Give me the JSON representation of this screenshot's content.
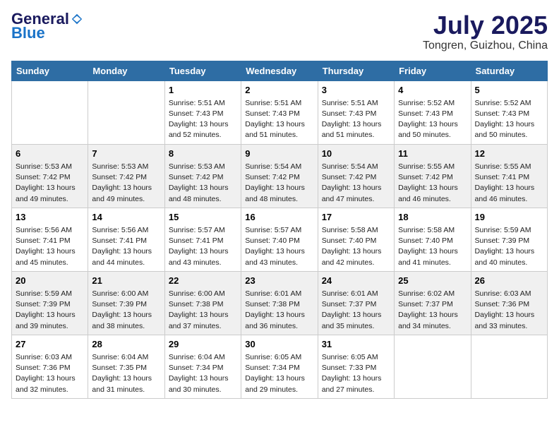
{
  "header": {
    "logo_general": "General",
    "logo_blue": "Blue",
    "month": "July 2025",
    "location": "Tongren, Guizhou, China"
  },
  "weekdays": [
    "Sunday",
    "Monday",
    "Tuesday",
    "Wednesday",
    "Thursday",
    "Friday",
    "Saturday"
  ],
  "weeks": [
    [
      {
        "day": "",
        "info": ""
      },
      {
        "day": "",
        "info": ""
      },
      {
        "day": "1",
        "info": "Sunrise: 5:51 AM\nSunset: 7:43 PM\nDaylight: 13 hours\nand 52 minutes."
      },
      {
        "day": "2",
        "info": "Sunrise: 5:51 AM\nSunset: 7:43 PM\nDaylight: 13 hours\nand 51 minutes."
      },
      {
        "day": "3",
        "info": "Sunrise: 5:51 AM\nSunset: 7:43 PM\nDaylight: 13 hours\nand 51 minutes."
      },
      {
        "day": "4",
        "info": "Sunrise: 5:52 AM\nSunset: 7:43 PM\nDaylight: 13 hours\nand 50 minutes."
      },
      {
        "day": "5",
        "info": "Sunrise: 5:52 AM\nSunset: 7:43 PM\nDaylight: 13 hours\nand 50 minutes."
      }
    ],
    [
      {
        "day": "6",
        "info": "Sunrise: 5:53 AM\nSunset: 7:42 PM\nDaylight: 13 hours\nand 49 minutes."
      },
      {
        "day": "7",
        "info": "Sunrise: 5:53 AM\nSunset: 7:42 PM\nDaylight: 13 hours\nand 49 minutes."
      },
      {
        "day": "8",
        "info": "Sunrise: 5:53 AM\nSunset: 7:42 PM\nDaylight: 13 hours\nand 48 minutes."
      },
      {
        "day": "9",
        "info": "Sunrise: 5:54 AM\nSunset: 7:42 PM\nDaylight: 13 hours\nand 48 minutes."
      },
      {
        "day": "10",
        "info": "Sunrise: 5:54 AM\nSunset: 7:42 PM\nDaylight: 13 hours\nand 47 minutes."
      },
      {
        "day": "11",
        "info": "Sunrise: 5:55 AM\nSunset: 7:42 PM\nDaylight: 13 hours\nand 46 minutes."
      },
      {
        "day": "12",
        "info": "Sunrise: 5:55 AM\nSunset: 7:41 PM\nDaylight: 13 hours\nand 46 minutes."
      }
    ],
    [
      {
        "day": "13",
        "info": "Sunrise: 5:56 AM\nSunset: 7:41 PM\nDaylight: 13 hours\nand 45 minutes."
      },
      {
        "day": "14",
        "info": "Sunrise: 5:56 AM\nSunset: 7:41 PM\nDaylight: 13 hours\nand 44 minutes."
      },
      {
        "day": "15",
        "info": "Sunrise: 5:57 AM\nSunset: 7:41 PM\nDaylight: 13 hours\nand 43 minutes."
      },
      {
        "day": "16",
        "info": "Sunrise: 5:57 AM\nSunset: 7:40 PM\nDaylight: 13 hours\nand 43 minutes."
      },
      {
        "day": "17",
        "info": "Sunrise: 5:58 AM\nSunset: 7:40 PM\nDaylight: 13 hours\nand 42 minutes."
      },
      {
        "day": "18",
        "info": "Sunrise: 5:58 AM\nSunset: 7:40 PM\nDaylight: 13 hours\nand 41 minutes."
      },
      {
        "day": "19",
        "info": "Sunrise: 5:59 AM\nSunset: 7:39 PM\nDaylight: 13 hours\nand 40 minutes."
      }
    ],
    [
      {
        "day": "20",
        "info": "Sunrise: 5:59 AM\nSunset: 7:39 PM\nDaylight: 13 hours\nand 39 minutes."
      },
      {
        "day": "21",
        "info": "Sunrise: 6:00 AM\nSunset: 7:39 PM\nDaylight: 13 hours\nand 38 minutes."
      },
      {
        "day": "22",
        "info": "Sunrise: 6:00 AM\nSunset: 7:38 PM\nDaylight: 13 hours\nand 37 minutes."
      },
      {
        "day": "23",
        "info": "Sunrise: 6:01 AM\nSunset: 7:38 PM\nDaylight: 13 hours\nand 36 minutes."
      },
      {
        "day": "24",
        "info": "Sunrise: 6:01 AM\nSunset: 7:37 PM\nDaylight: 13 hours\nand 35 minutes."
      },
      {
        "day": "25",
        "info": "Sunrise: 6:02 AM\nSunset: 7:37 PM\nDaylight: 13 hours\nand 34 minutes."
      },
      {
        "day": "26",
        "info": "Sunrise: 6:03 AM\nSunset: 7:36 PM\nDaylight: 13 hours\nand 33 minutes."
      }
    ],
    [
      {
        "day": "27",
        "info": "Sunrise: 6:03 AM\nSunset: 7:36 PM\nDaylight: 13 hours\nand 32 minutes."
      },
      {
        "day": "28",
        "info": "Sunrise: 6:04 AM\nSunset: 7:35 PM\nDaylight: 13 hours\nand 31 minutes."
      },
      {
        "day": "29",
        "info": "Sunrise: 6:04 AM\nSunset: 7:34 PM\nDaylight: 13 hours\nand 30 minutes."
      },
      {
        "day": "30",
        "info": "Sunrise: 6:05 AM\nSunset: 7:34 PM\nDaylight: 13 hours\nand 29 minutes."
      },
      {
        "day": "31",
        "info": "Sunrise: 6:05 AM\nSunset: 7:33 PM\nDaylight: 13 hours\nand 27 minutes."
      },
      {
        "day": "",
        "info": ""
      },
      {
        "day": "",
        "info": ""
      }
    ]
  ]
}
